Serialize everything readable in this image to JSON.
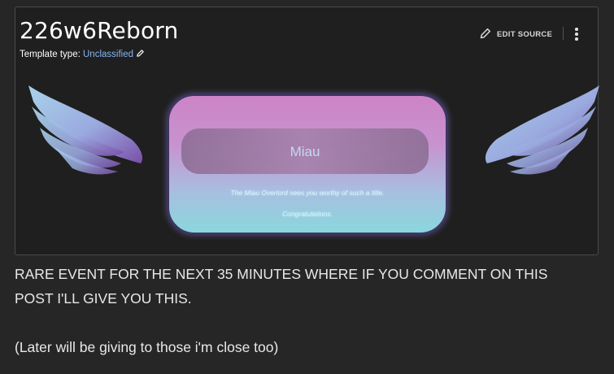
{
  "page": {
    "title": "226w6Reborn",
    "template_type_label": "Template type:",
    "template_type_value": "Unclassified",
    "edit_source_label": "EDIT SOURCE"
  },
  "banner": {
    "name": "Miau",
    "subtitle": "The Miau Overlord sees you worthy of such a title.",
    "congrats": "Congratulations."
  },
  "post": {
    "paragraph1": "RARE EVENT FOR THE NEXT 35 MINUTES WHERE IF YOU COMMENT ON THIS POST I'LL GIVE YOU THIS.",
    "paragraph2": "(Later will be giving to those i'm close too)"
  },
  "icons": {
    "edit": "pencil-icon",
    "more": "kebab-menu-icon",
    "wings": "wing-icon"
  },
  "colors": {
    "background": "#262626",
    "card": "#1f1f1f",
    "link": "#8ab4f0",
    "banner_top": "#cc84c6",
    "banner_bottom": "#8ad7dd"
  }
}
